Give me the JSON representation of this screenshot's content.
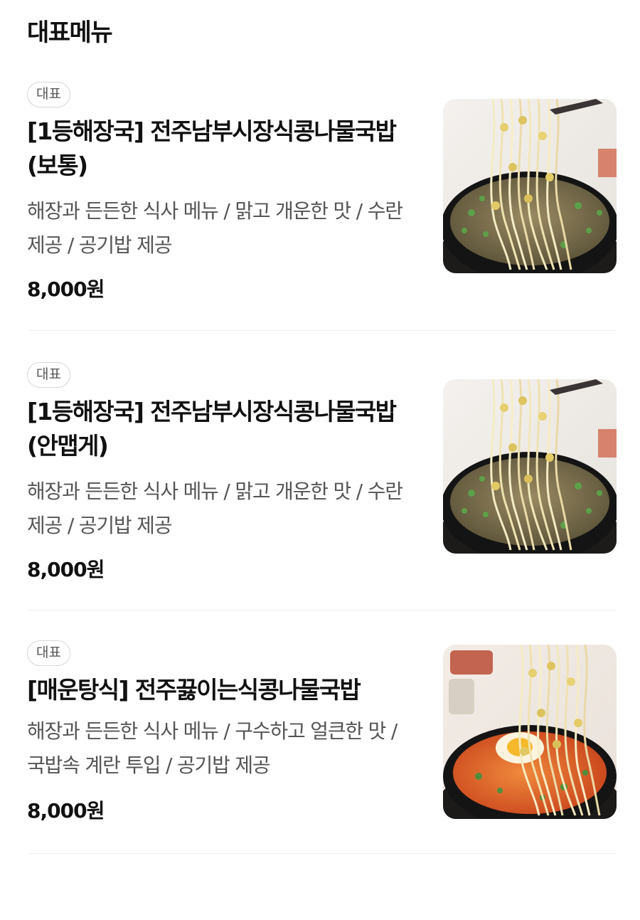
{
  "section": {
    "title": "대표메뉴"
  },
  "items": [
    {
      "badge": "대표",
      "name": "[1등해장국] 전주남부시장식콩나물국밥(보통)",
      "description": "해장과 든든한 식사 메뉴 / 맑고 개운한 맛 / 수란 제공 / 공기밥 제공",
      "price": "8,000원",
      "photo": "clear-bean-sprout-soup-photo"
    },
    {
      "badge": "대표",
      "name": "[1등해장국] 전주남부시장식콩나물국밥(안맵게)",
      "description": "해장과 든든한 식사 메뉴 / 맑고 개운한 맛 / 수란 제공 / 공기밥 제공",
      "price": "8,000원",
      "photo": "clear-bean-sprout-soup-photo"
    },
    {
      "badge": "대표",
      "name": "[매운탕식] 전주끓이는식콩나물국밥",
      "description": "해장과 든든한 식사 메뉴 / 구수하고 얼큰한 맛 / 국밥속 계란 투입 / 공기밥 제공",
      "price": "8,000원",
      "photo": "spicy-bean-sprout-soup-photo"
    }
  ],
  "colors": {
    "text": "#111111",
    "muted": "#555555",
    "badge_border": "#d6d6d6",
    "divider": "#ececec"
  }
}
